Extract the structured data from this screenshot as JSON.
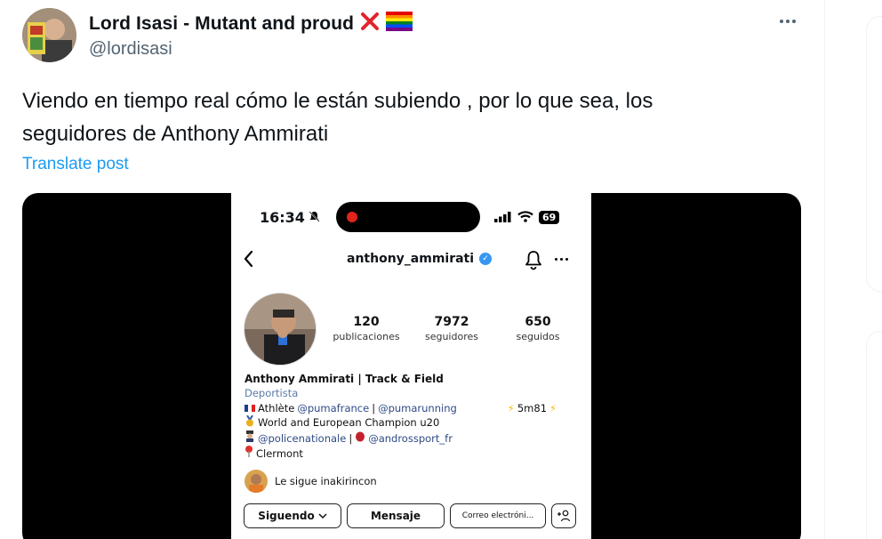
{
  "tweet": {
    "author": {
      "display_name": "Lord Isasi - Mutant and proud",
      "handle": "@lordisasi",
      "name_emoji_icons": [
        "cross-mark-icon",
        "rainbow-flag-icon"
      ]
    },
    "text_line1": "Viendo en tiempo real cómo le están subiendo , por lo que sea, los",
    "text_line2": "seguidores de Anthony Ammirati",
    "translate_label": "Translate post"
  },
  "instagram": {
    "status": {
      "time": "16:34",
      "battery": "69"
    },
    "username": "anthony_ammirati",
    "stats": [
      {
        "num": "120",
        "label": "publicaciones"
      },
      {
        "num": "7972",
        "label": "seguidores"
      },
      {
        "num": "650",
        "label": "seguidos"
      }
    ],
    "bio": {
      "name": "Anthony Ammirati | Track & Field",
      "category": "Deportista",
      "line_athlete": "Athlète",
      "link_puma_france": "@pumafrance",
      "sep1": "|",
      "link_puma_running": "@pumarunning",
      "record": "5m81",
      "line_champion": "World and European Champion u20",
      "link_police": "@policenationale",
      "sep2": "|",
      "link_andros": "@androssport_fr",
      "location": "Clermont"
    },
    "followed_by": "Le sigue inakirincon",
    "buttons": {
      "following": "Siguendo",
      "message": "Mensaje",
      "email": "Correo electróni..."
    }
  },
  "colors": {
    "link_blue": "#1d9bf0",
    "muted": "#536471",
    "ig_verified": "#3797f0"
  }
}
